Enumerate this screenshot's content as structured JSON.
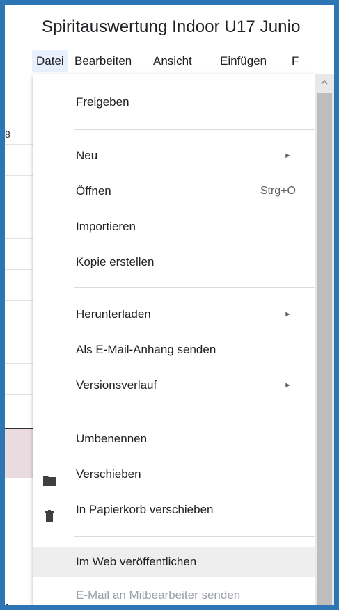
{
  "document": {
    "title": "Spiritauswertung Indoor U17 Junio"
  },
  "menubar": {
    "items": [
      {
        "label": "Datei"
      },
      {
        "label": "Bearbeiten"
      },
      {
        "label": "Ansicht"
      },
      {
        "label": "Einfügen"
      },
      {
        "label": "F"
      }
    ]
  },
  "sheet": {
    "row_labels": [
      "8",
      "1"
    ]
  },
  "file_menu": {
    "share": "Freigeben",
    "new": "Neu",
    "open": "Öffnen",
    "open_shortcut": "Strg+O",
    "import": "Importieren",
    "copy": "Kopie erstellen",
    "download": "Herunterladen",
    "email_attachment": "Als E-Mail-Anhang senden",
    "version_history": "Versionsverlauf",
    "rename": "Umbenennen",
    "move": "Verschieben",
    "trash": "In Papierkorb verschieben",
    "publish_web": "Im Web veröffentlichen",
    "email_collaborators": "E-Mail an Mitbearbeiter senden",
    "submenu_arrow": "►",
    "icons": {
      "move": "folder-icon",
      "trash": "trash-icon"
    }
  },
  "colors": {
    "frame": "#2e75b6",
    "hover": "#eeeeee",
    "active_menu": "#e8f0fe"
  }
}
